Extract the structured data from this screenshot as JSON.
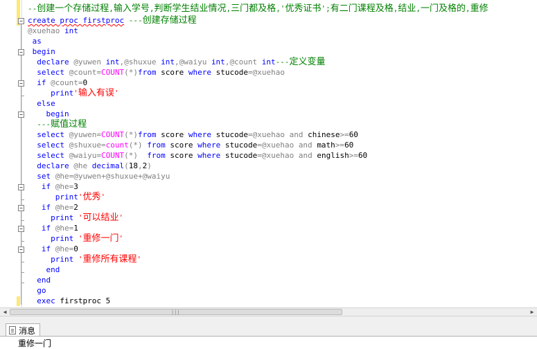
{
  "editor": {
    "lines": [
      [
        {
          "t": "--创建一个存储过程,输入学号,判断学生结业情况,三门都及格,'优秀证书';有二门课程及格,结业,一门及格的,重修",
          "c": "cm"
        }
      ],
      [
        {
          "t": "create proc firstproc",
          "c": "kw sq"
        },
        {
          "t": " ---创建存储过程",
          "c": "cm"
        }
      ],
      [
        {
          "t": "@xuehao ",
          "c": "gr"
        },
        {
          "t": "int",
          "c": "kw"
        }
      ],
      [
        {
          "t": " as",
          "c": "kw"
        }
      ],
      [
        {
          "t": " begin",
          "c": "kw"
        }
      ],
      [
        {
          "t": "  declare ",
          "c": "kw"
        },
        {
          "t": "@yuwen ",
          "c": "gr"
        },
        {
          "t": "int",
          "c": "kw"
        },
        {
          "t": ",",
          "c": "gr"
        },
        {
          "t": "@shuxue ",
          "c": "gr"
        },
        {
          "t": "int",
          "c": "kw"
        },
        {
          "t": ",",
          "c": "gr"
        },
        {
          "t": "@waiyu ",
          "c": "gr"
        },
        {
          "t": "int",
          "c": "kw"
        },
        {
          "t": ",",
          "c": "gr"
        },
        {
          "t": "@count ",
          "c": "gr"
        },
        {
          "t": "int",
          "c": "kw"
        },
        {
          "t": "---定义变量",
          "c": "cm"
        }
      ],
      [
        {
          "t": "  select ",
          "c": "kw"
        },
        {
          "t": "@count",
          "c": "gr"
        },
        {
          "t": "=",
          "c": "gr"
        },
        {
          "t": "COUNT",
          "c": "fn"
        },
        {
          "t": "(*)",
          "c": "gr"
        },
        {
          "t": "from ",
          "c": "kw"
        },
        {
          "t": "score ",
          "c": "tx"
        },
        {
          "t": "where ",
          "c": "kw"
        },
        {
          "t": "stucode",
          "c": "tx"
        },
        {
          "t": "=",
          "c": "gr"
        },
        {
          "t": "@xuehao",
          "c": "gr"
        }
      ],
      [
        {
          "t": "  if ",
          "c": "kw"
        },
        {
          "t": "@count",
          "c": "gr"
        },
        {
          "t": "=",
          "c": "gr"
        },
        {
          "t": "0",
          "c": "tx"
        }
      ],
      [
        {
          "t": "     print",
          "c": "kw"
        },
        {
          "t": "'输入有误'",
          "c": "st"
        }
      ],
      [
        {
          "t": "  else",
          "c": "kw"
        }
      ],
      [
        {
          "t": "    begin",
          "c": "kw"
        }
      ],
      [
        {
          "t": "  ---赋值过程",
          "c": "cm"
        }
      ],
      [
        {
          "t": "  select ",
          "c": "kw"
        },
        {
          "t": "@yuwen",
          "c": "gr"
        },
        {
          "t": "=",
          "c": "gr"
        },
        {
          "t": "COUNT",
          "c": "fn"
        },
        {
          "t": "(*)",
          "c": "gr"
        },
        {
          "t": "from ",
          "c": "kw"
        },
        {
          "t": "score ",
          "c": "tx"
        },
        {
          "t": "where ",
          "c": "kw"
        },
        {
          "t": "stucode",
          "c": "tx"
        },
        {
          "t": "=",
          "c": "gr"
        },
        {
          "t": "@xuehao ",
          "c": "gr"
        },
        {
          "t": "and ",
          "c": "gr"
        },
        {
          "t": "chinese",
          "c": "tx"
        },
        {
          "t": ">=",
          "c": "gr"
        },
        {
          "t": "60",
          "c": "tx"
        }
      ],
      [
        {
          "t": "  select ",
          "c": "kw"
        },
        {
          "t": "@shuxue",
          "c": "gr"
        },
        {
          "t": "=",
          "c": "gr"
        },
        {
          "t": "count",
          "c": "fn"
        },
        {
          "t": "(*) ",
          "c": "gr"
        },
        {
          "t": "from ",
          "c": "kw"
        },
        {
          "t": "score ",
          "c": "tx"
        },
        {
          "t": "where ",
          "c": "kw"
        },
        {
          "t": "stucode",
          "c": "tx"
        },
        {
          "t": "=",
          "c": "gr"
        },
        {
          "t": "@xuehao ",
          "c": "gr"
        },
        {
          "t": "and ",
          "c": "gr"
        },
        {
          "t": "math",
          "c": "tx"
        },
        {
          "t": ">=",
          "c": "gr"
        },
        {
          "t": "60",
          "c": "tx"
        }
      ],
      [
        {
          "t": "  select ",
          "c": "kw"
        },
        {
          "t": "@waiyu",
          "c": "gr"
        },
        {
          "t": "=",
          "c": "gr"
        },
        {
          "t": "COUNT",
          "c": "fn"
        },
        {
          "t": "(*)  ",
          "c": "gr"
        },
        {
          "t": "from ",
          "c": "kw"
        },
        {
          "t": "score ",
          "c": "tx"
        },
        {
          "t": "where ",
          "c": "kw"
        },
        {
          "t": "stucode",
          "c": "tx"
        },
        {
          "t": "=",
          "c": "gr"
        },
        {
          "t": "@xuehao ",
          "c": "gr"
        },
        {
          "t": "and ",
          "c": "gr"
        },
        {
          "t": "english",
          "c": "tx"
        },
        {
          "t": ">=",
          "c": "gr"
        },
        {
          "t": "60",
          "c": "tx"
        }
      ],
      [
        {
          "t": "  declare ",
          "c": "kw"
        },
        {
          "t": "@he ",
          "c": "gr"
        },
        {
          "t": "decimal",
          "c": "kw"
        },
        {
          "t": "(",
          "c": "gr"
        },
        {
          "t": "18",
          "c": "tx"
        },
        {
          "t": ",",
          "c": "gr"
        },
        {
          "t": "2",
          "c": "tx"
        },
        {
          "t": ")",
          "c": "gr"
        }
      ],
      [
        {
          "t": "  set ",
          "c": "kw"
        },
        {
          "t": "@he",
          "c": "gr"
        },
        {
          "t": "=",
          "c": "gr"
        },
        {
          "t": "@yuwen",
          "c": "gr"
        },
        {
          "t": "+",
          "c": "gr"
        },
        {
          "t": "@shuxue",
          "c": "gr"
        },
        {
          "t": "+",
          "c": "gr"
        },
        {
          "t": "@waiyu",
          "c": "gr"
        }
      ],
      [
        {
          "t": "   if ",
          "c": "kw"
        },
        {
          "t": "@he",
          "c": "gr"
        },
        {
          "t": "=",
          "c": "gr"
        },
        {
          "t": "3",
          "c": "tx"
        }
      ],
      [
        {
          "t": "      print",
          "c": "kw"
        },
        {
          "t": "'优秀'",
          "c": "st"
        }
      ],
      [
        {
          "t": "   if ",
          "c": "kw"
        },
        {
          "t": "@he",
          "c": "gr"
        },
        {
          "t": "=",
          "c": "gr"
        },
        {
          "t": "2",
          "c": "tx"
        }
      ],
      [
        {
          "t": "     print ",
          "c": "kw"
        },
        {
          "t": "'可以结业'",
          "c": "st"
        }
      ],
      [
        {
          "t": "   if ",
          "c": "kw"
        },
        {
          "t": "@he",
          "c": "gr"
        },
        {
          "t": "=",
          "c": "gr"
        },
        {
          "t": "1",
          "c": "tx"
        }
      ],
      [
        {
          "t": "     print ",
          "c": "kw"
        },
        {
          "t": "'重修一门'",
          "c": "st"
        }
      ],
      [
        {
          "t": "   if ",
          "c": "kw"
        },
        {
          "t": "@he",
          "c": "gr"
        },
        {
          "t": "=",
          "c": "gr"
        },
        {
          "t": "0",
          "c": "tx"
        }
      ],
      [
        {
          "t": "     print ",
          "c": "kw"
        },
        {
          "t": "'重修所有课程'",
          "c": "st"
        }
      ],
      [
        {
          "t": "    end",
          "c": "kw"
        }
      ],
      [
        {
          "t": "  end",
          "c": "kw"
        }
      ],
      [
        {
          "t": "  go",
          "c": "kw"
        }
      ],
      [
        {
          "t": "  exec ",
          "c": "kw"
        },
        {
          "t": "firstproc ",
          "c": "tx"
        },
        {
          "t": "5",
          "c": "tx"
        }
      ]
    ]
  },
  "scrollbar": {
    "grip_glyph": "|||",
    "left_arrow": "◀",
    "right_arrow": "▶"
  },
  "messages_panel": {
    "tab_label": "消息",
    "message_text": "重修一门"
  },
  "colors": {
    "comment": "#008000",
    "keyword": "#0000ff",
    "function": "#ff00ff",
    "operator": "#808080",
    "string": "#ff0000",
    "change_bar": "#ffe873"
  }
}
